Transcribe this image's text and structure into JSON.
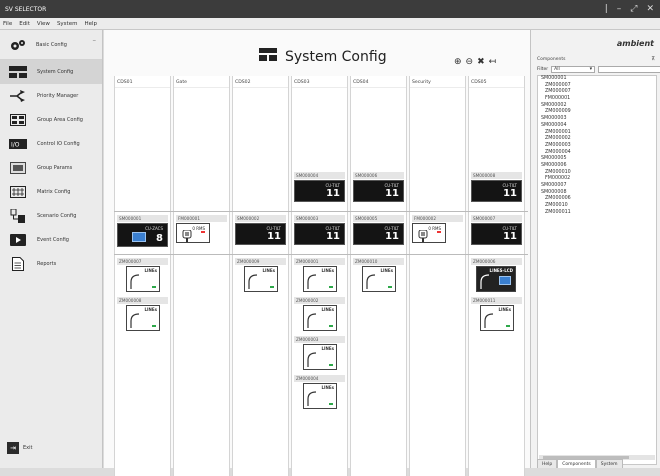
{
  "window": {
    "title": "SV SELECTOR",
    "controls": [
      "|",
      "–",
      "⤢",
      "✕"
    ]
  },
  "menu": [
    "File",
    "Edit",
    "View",
    "System",
    "Help"
  ],
  "sidebar": {
    "top_label": "Basic Config",
    "items": [
      {
        "label": "System Config",
        "icon": "system-config-icon",
        "active": true
      },
      {
        "label": "Priority Manager",
        "icon": "priority-manager-icon"
      },
      {
        "label": "Group Area Config",
        "icon": "group-area-icon"
      },
      {
        "label": "Control IO Config",
        "icon": "control-io-icon"
      },
      {
        "label": "Group Params",
        "icon": "group-params-icon"
      },
      {
        "label": "Matrix Config",
        "icon": "matrix-config-icon"
      },
      {
        "label": "Scenario Config",
        "icon": "scenario-config-icon"
      },
      {
        "label": "Event Config",
        "icon": "event-config-icon"
      },
      {
        "label": "Reports",
        "icon": "reports-icon"
      }
    ],
    "exit_label": "Exit"
  },
  "main": {
    "title": "System Config",
    "tools": [
      "zoom-in-icon",
      "zoom-out-icon",
      "delete-icon",
      "back-icon"
    ],
    "columns": [
      "CDS01",
      "Gate",
      "CDS02",
      "CDS03",
      "CDS04",
      "Security",
      "CDS05"
    ],
    "row1_labels": {
      "CDS03": "SM000004",
      "CDS04": "SM000006",
      "CDS05": "SM000008"
    },
    "row2_labels": [
      "SM000001",
      "FM000001",
      "SM000002",
      "SM000003",
      "SM000005",
      "FM000002",
      "SM000007"
    ],
    "tilt_text": "CU-TILT",
    "tilt_num": "11",
    "cu_text": "CU-ZACS",
    "cu_num": "8",
    "mic_text": "0 RMS",
    "zone_text": "LINEs",
    "zone_text2": "LINES-LCD",
    "zones": {
      "CDS01": [
        "ZM000007",
        "ZM000008"
      ],
      "CDS02": [
        "ZM000009"
      ],
      "CDS03": [
        "ZM000001",
        "ZM000002",
        "ZM000003",
        "ZM000004"
      ],
      "CDS04": [
        "ZM000010"
      ],
      "CDS05": [
        "ZM000006",
        "ZM000011"
      ]
    }
  },
  "panel": {
    "logo": "ambient",
    "title": "Components",
    "filter_label": "Filter",
    "filter_value": "All",
    "tree": [
      {
        "label": "SM000001",
        "child": false
      },
      {
        "label": "ZM000007",
        "child": true
      },
      {
        "label": "ZM000007",
        "child": true
      },
      {
        "label": "FM000001",
        "child": true
      },
      {
        "label": "SM000002",
        "child": false
      },
      {
        "label": "ZM000009",
        "child": true
      },
      {
        "label": "SM000003",
        "child": false
      },
      {
        "label": "SM000004",
        "child": false
      },
      {
        "label": "ZM000001",
        "child": true
      },
      {
        "label": "ZM000002",
        "child": true
      },
      {
        "label": "ZM000003",
        "child": true
      },
      {
        "label": "ZM000004",
        "child": true
      },
      {
        "label": "SM000005",
        "child": false
      },
      {
        "label": "SM000006",
        "child": false
      },
      {
        "label": "ZM000010",
        "child": true
      },
      {
        "label": "FM000002",
        "child": true
      },
      {
        "label": "SM000007",
        "child": false
      },
      {
        "label": "SM000008",
        "child": false
      },
      {
        "label": "ZM000006",
        "child": true
      },
      {
        "label": "ZM00010",
        "child": true
      },
      {
        "label": "ZM000011",
        "child": true
      }
    ],
    "tabs": [
      "Help",
      "Components",
      "System"
    ]
  }
}
